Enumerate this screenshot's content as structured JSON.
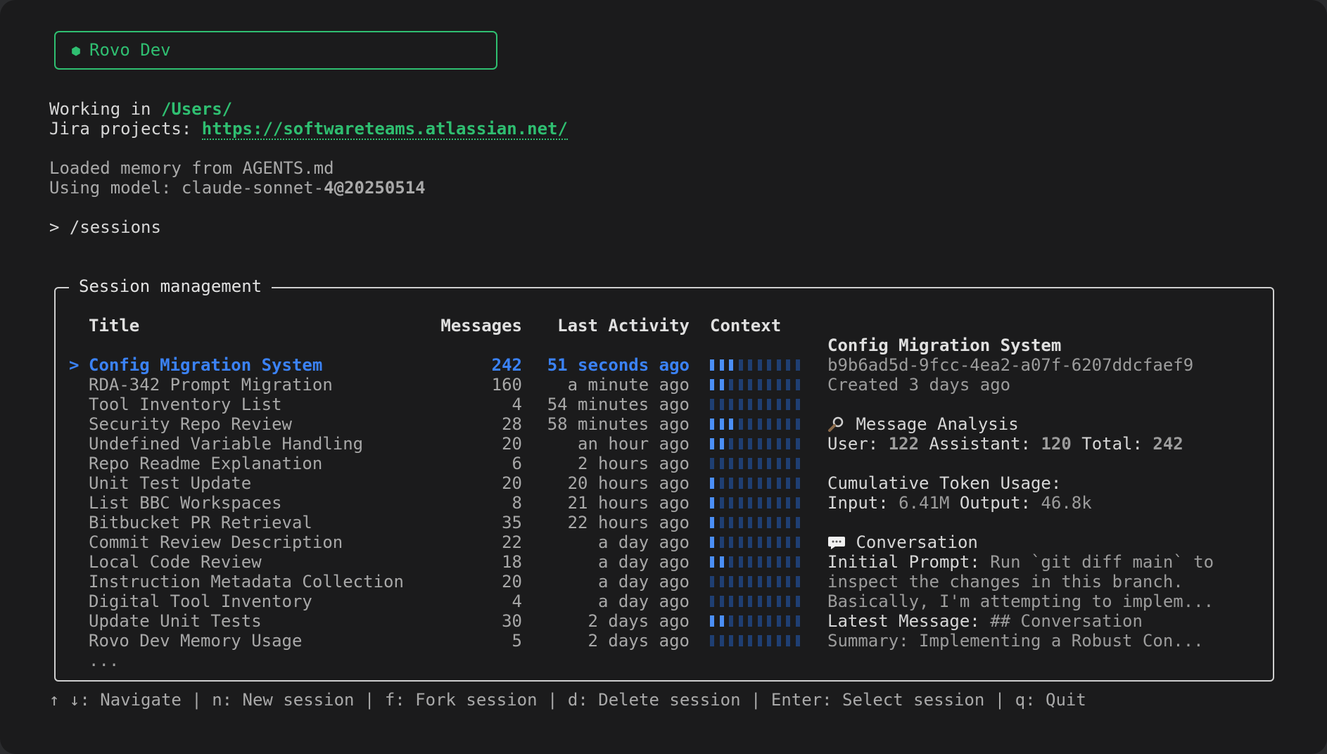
{
  "app": {
    "name": "Rovo Dev"
  },
  "info": {
    "working_label": "Working in ",
    "working_path": "/Users/",
    "jira_label": "Jira projects: ",
    "jira_url": "https://softwareteams.atlassian.net/",
    "memory_line": "Loaded memory from AGENTS.md",
    "model_label": "Using model: claude-sonnet-",
    "model_num": "4@20250514"
  },
  "prompt": {
    "symbol": ">",
    "command": "/sessions"
  },
  "panel": {
    "title": "Session management",
    "columns": {
      "title": "Title",
      "messages": "Messages",
      "last_activity": "Last Activity",
      "context": "Context"
    },
    "cursor": ">",
    "more": "...",
    "sessions": [
      {
        "title": "Config Migration System",
        "messages": "242",
        "activity": "51 seconds ago",
        "context": 0.3,
        "selected": true
      },
      {
        "title": "RDA-342 Prompt Migration",
        "messages": "160",
        "activity": "a minute ago",
        "context": 0.2
      },
      {
        "title": "Tool Inventory List",
        "messages": "4",
        "activity": "54 minutes ago",
        "context": 0.0
      },
      {
        "title": "Security Repo Review",
        "messages": "28",
        "activity": "58 minutes ago",
        "context": 0.3
      },
      {
        "title": "Undefined Variable Handling",
        "messages": "20",
        "activity": "an hour ago",
        "context": 0.2
      },
      {
        "title": "Repo Readme Explanation",
        "messages": "6",
        "activity": "2 hours ago",
        "context": 0.0
      },
      {
        "title": "Unit Test Update",
        "messages": "20",
        "activity": "20 hours ago",
        "context": 0.1
      },
      {
        "title": "List BBC Workspaces",
        "messages": "8",
        "activity": "21 hours ago",
        "context": 0.1
      },
      {
        "title": "Bitbucket PR Retrieval",
        "messages": "35",
        "activity": "22 hours ago",
        "context": 0.1
      },
      {
        "title": "Commit Review Description",
        "messages": "22",
        "activity": "a day ago",
        "context": 0.1
      },
      {
        "title": "Local Code Review",
        "messages": "18",
        "activity": "a day ago",
        "context": 0.2
      },
      {
        "title": "Instruction Metadata Collection",
        "messages": "20",
        "activity": "a day ago",
        "context": 0.0
      },
      {
        "title": "Digital Tool Inventory",
        "messages": "4",
        "activity": "a day ago",
        "context": 0.0
      },
      {
        "title": "Update Unit Tests",
        "messages": "30",
        "activity": "2 days ago",
        "context": 0.2
      },
      {
        "title": "Rovo Dev Memory Usage",
        "messages": "5",
        "activity": "2 days ago",
        "context": 0.0
      }
    ]
  },
  "details": {
    "title": "Config Migration System",
    "id": "b9b6ad5d-9fcc-4ea2-a07f-6207ddcfaef9",
    "created": "Created 3 days ago",
    "analysis_heading": "Message Analysis",
    "analysis_icon": "magnifier-icon",
    "user_label": "User: ",
    "user_count": "122",
    "assistant_label": " Assistant: ",
    "assistant_count": "120",
    "total_label": " Total: ",
    "total_count": "242",
    "token_heading": "Cumulative Token Usage:",
    "input_label": "Input: ",
    "input_value": "6.41M",
    "output_label": " Output: ",
    "output_value": "46.8k",
    "conversation_heading": "Conversation",
    "conversation_icon": "speech-bubble-icon",
    "initial_label": "Initial Prompt: ",
    "initial_line1": "Run `git diff main` to",
    "initial_line2": "inspect the changes in this branch.",
    "initial_line3": "Basically, I'm attempting to implem...",
    "latest_label": "Latest Message: ",
    "latest_line1": "## Conversation",
    "latest_line2": "Summary: Implementing a Robust Con..."
  },
  "footer": {
    "hints": "↑ ↓: Navigate | n: New session | f: Fork session | d: Delete session | Enter: Select session | q: Quit"
  },
  "colors": {
    "accent_green": "#2fbf71",
    "selection_blue": "#3b82f6",
    "bar_on": "#4b8ff7",
    "bar_off": "#1f3f73"
  }
}
